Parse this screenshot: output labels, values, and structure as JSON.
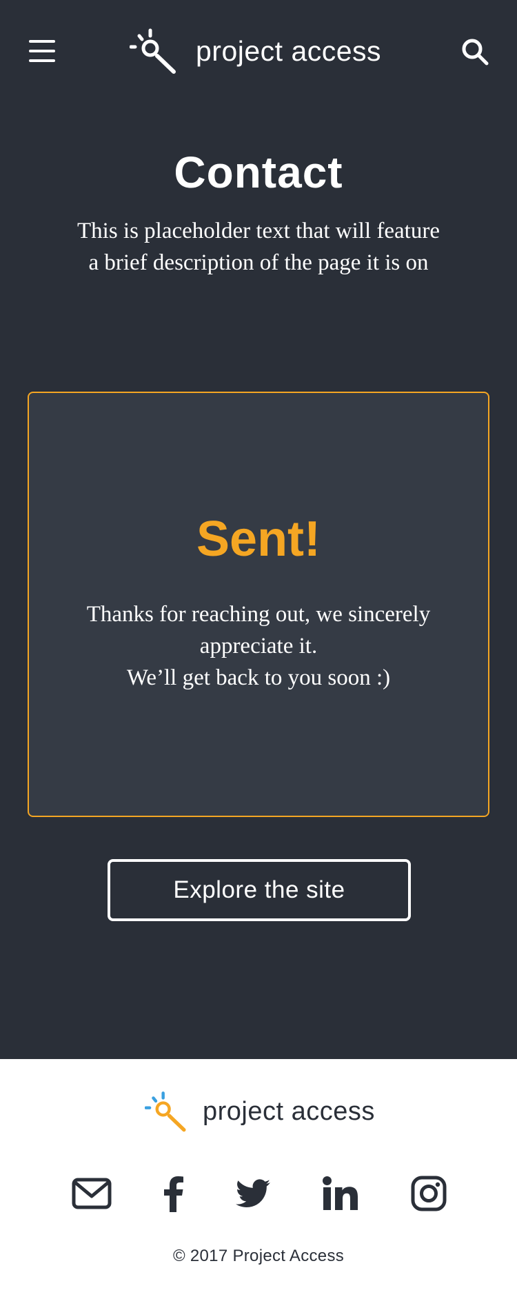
{
  "header": {
    "brand_name": "project access",
    "menu_icon": "hamburger-menu-icon",
    "search_icon": "search-icon"
  },
  "hero": {
    "title": "Contact",
    "description": "This is placeholder text that will feature a brief description of the page it is on"
  },
  "sent_card": {
    "title": "Sent!",
    "message_line1": "Thanks for reaching out, we sincerely appreciate it.",
    "message_line2": "We’ll get back to you soon :)"
  },
  "cta": {
    "label": "Explore the site"
  },
  "footer": {
    "brand_name": "project access",
    "social": [
      {
        "icon": "email-icon"
      },
      {
        "icon": "facebook-icon"
      },
      {
        "icon": "twitter-icon"
      },
      {
        "icon": "linkedin-icon"
      },
      {
        "icon": "instagram-icon"
      }
    ],
    "copyright": "© 2017 Project Access"
  },
  "colors": {
    "background_dark": "#2a2f38",
    "card": "#353b45",
    "accent_orange": "#f5a623",
    "accent_blue": "#3aa0e0",
    "white": "#ffffff"
  }
}
